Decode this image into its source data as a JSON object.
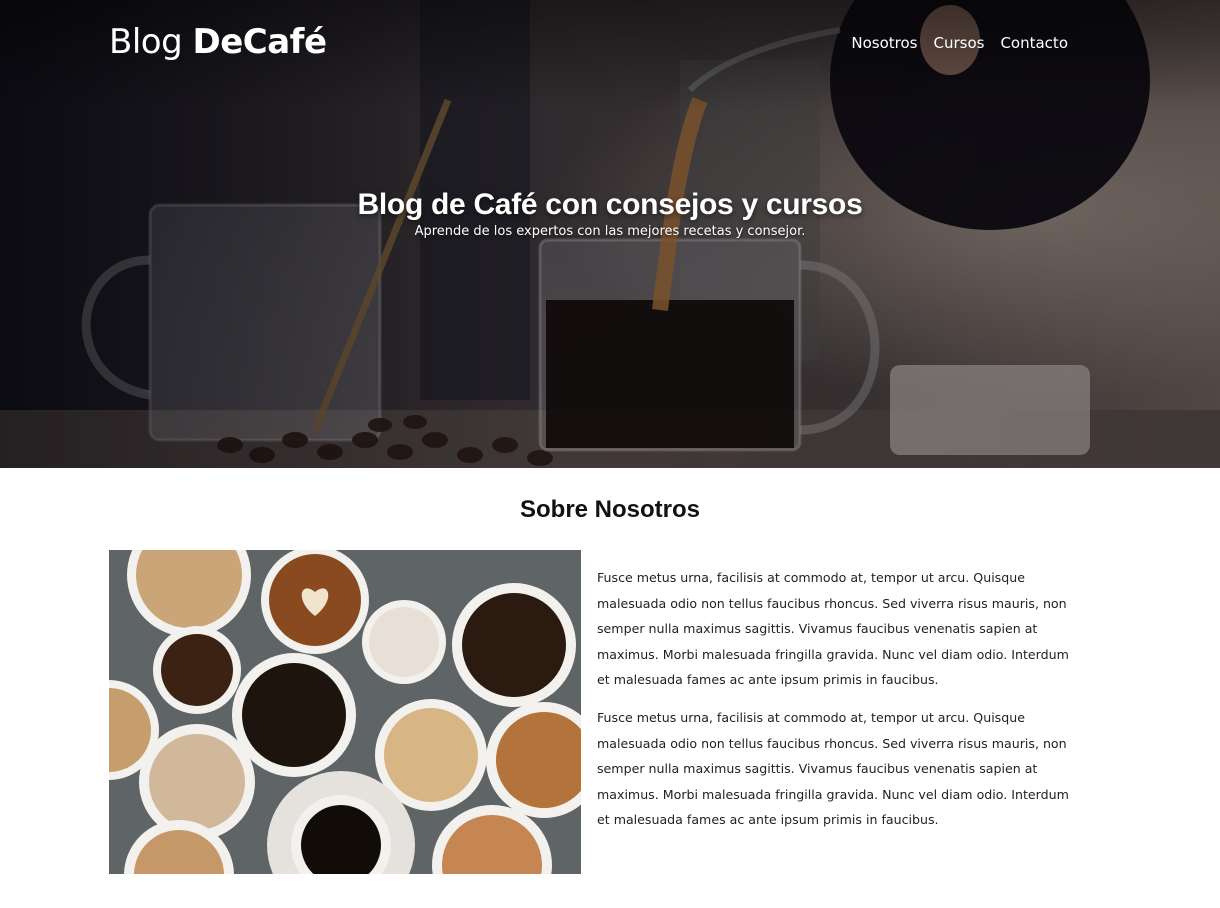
{
  "header": {
    "logo_light": "Blog ",
    "logo_bold": "DeCafé",
    "nav": [
      "Nosotros",
      "Cursos",
      "Contacto"
    ]
  },
  "hero": {
    "title": "Blog de Café con consejos y cursos",
    "subtitle": "Aprende de los expertos con las mejores recetas y consejor."
  },
  "about": {
    "title": "Sobre Nosotros",
    "paragraphs": [
      "Fusce metus urna, facilisis at commodo at, tempor ut arcu. Quisque malesuada odio non tellus faucibus rhoncus. Sed viverra risus mauris, non semper nulla maximus sagittis. Vivamus faucibus venenatis sapien at maximus. Morbi malesuada fringilla gravida. Nunc vel diam odio. Interdum et malesuada fames ac ante ipsum primis in faucibus.",
      "Fusce metus urna, facilisis at commodo at, tempor ut arcu. Quisque malesuada odio non tellus faucibus rhoncus. Sed viverra risus mauris, non semper nulla maximus sagittis. Vivamus faucibus venenatis sapien at maximus. Morbi malesuada fringilla gravida. Nunc vel diam odio. Interdum et malesuada fames ac ante ipsum primis in faucibus."
    ]
  },
  "colors": {
    "text_dark": "#111111",
    "hero_text": "#ffffff"
  }
}
